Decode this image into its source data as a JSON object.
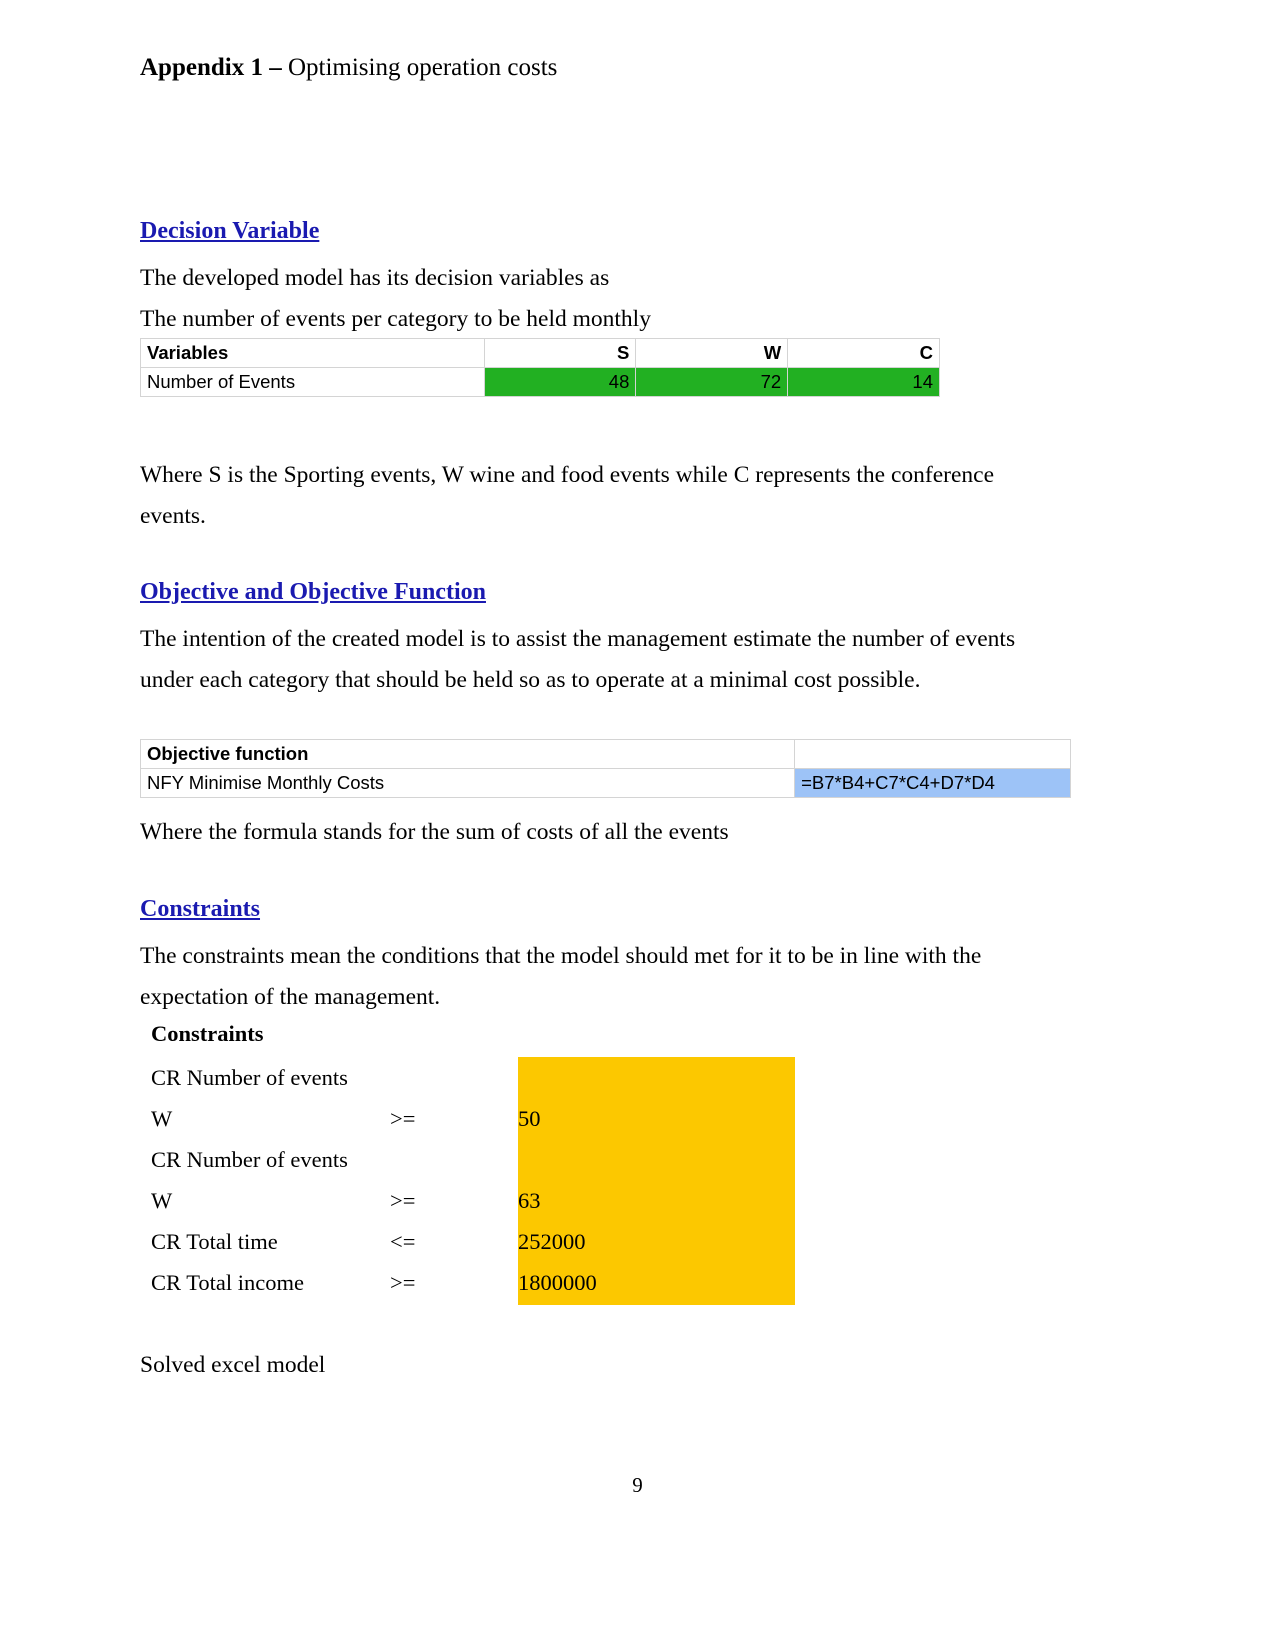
{
  "document": {
    "title_strong": "Appendix 1 – ",
    "title_rest": "Optimising operation costs",
    "page_number": "9"
  },
  "sections": {
    "decision_variable": {
      "heading": "Decision Variable",
      "paragraph_1": "The developed model has its decision variables as",
      "paragraph_2": "The number of events per category to be held monthly",
      "note": "Where S is the Sporting events, W wine and food events while C represents the conference events."
    },
    "objective": {
      "heading": "Objective and Objective Function",
      "paragraph_1": "The intention of the created model is to assist the management estimate the number of events under each category that should be held so as to operate at a minimal cost possible.",
      "note": "Where the formula stands for the sum of costs of all the events"
    },
    "constraints": {
      "heading": "Constraints",
      "paragraph_1": "The constraints mean the conditions that the model should met for it to be in line with the expectation of the management.",
      "note": "Solved excel model"
    }
  },
  "variables_table": {
    "header": {
      "label": "Variables",
      "s": "S",
      "w": "W",
      "c": "C"
    },
    "row": {
      "label": "Number of Events",
      "s": "48",
      "w": "72",
      "c": "14"
    },
    "highlight_color": "#22B022"
  },
  "objective_table": {
    "header": {
      "label": "Objective function",
      "formula_header": ""
    },
    "row": {
      "label": "NFY Minimise Monthly Costs",
      "formula": "=B7*B4+C7*C4+D7*D4"
    },
    "highlight_color": "#9DC3F7"
  },
  "constraints_table": {
    "heading": "Constraints",
    "highlight_color": "#FCC800",
    "rows": [
      {
        "label": "CR Number of events",
        "op": "",
        "value": ""
      },
      {
        "label": "W",
        "op": ">=",
        "value": "50"
      },
      {
        "label": "CR Number of events",
        "op": "",
        "value": ""
      },
      {
        "label": "W",
        "op": ">=",
        "value": "63"
      },
      {
        "label": "CR Total time",
        "op": "<=",
        "value": "252000"
      },
      {
        "label": "CR Total income",
        "op": ">=",
        "value": "1800000"
      }
    ]
  }
}
